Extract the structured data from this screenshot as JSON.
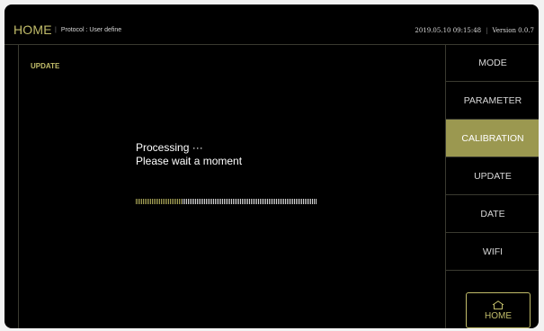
{
  "header": {
    "title": "HOME",
    "separator": "|",
    "protocol": "Protocol : User define",
    "datetime": "2019.05.10 09:15:48",
    "version": "Version 0.0.7"
  },
  "main": {
    "section_label": "UPDATE",
    "message_line1": "Processing   ···",
    "message_line2": "Please wait a moment",
    "progress": 0.25
  },
  "sidebar": {
    "items": [
      {
        "label": "MODE"
      },
      {
        "label": "PARAMETER"
      },
      {
        "label": "CALIBRATION",
        "active": true
      },
      {
        "label": "UPDATE"
      },
      {
        "label": "DATE"
      },
      {
        "label": "WIFI"
      }
    ],
    "home_button": {
      "label": "HOME",
      "icon": "home-icon"
    }
  },
  "colors": {
    "accent": "#c2bd6a",
    "active_bg": "#9b9850",
    "background": "#000000"
  }
}
